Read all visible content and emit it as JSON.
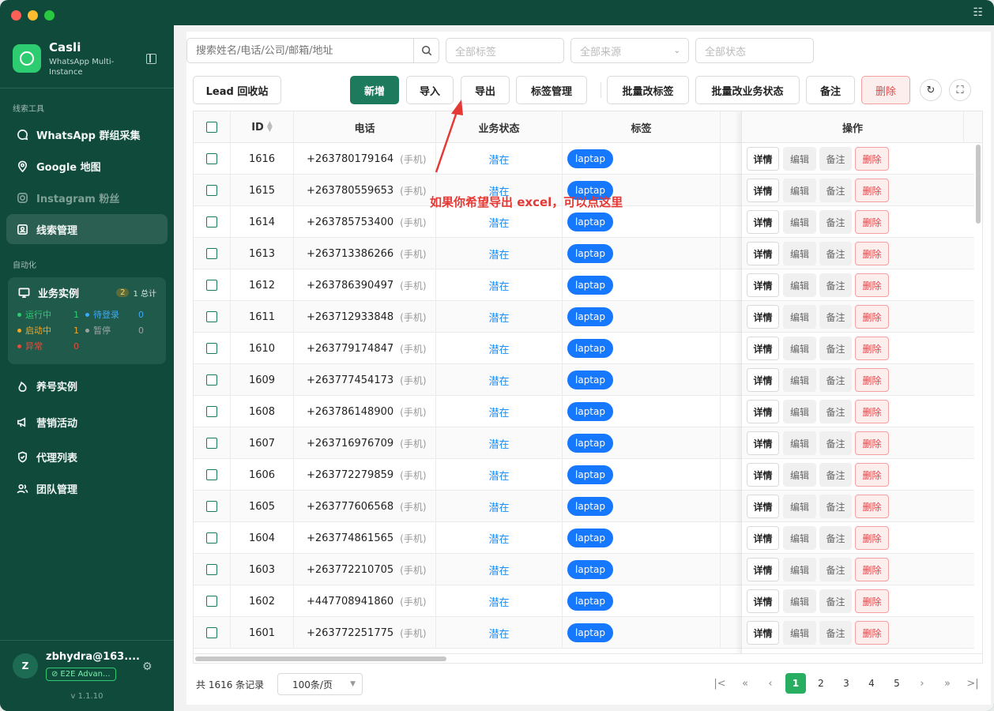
{
  "window": {
    "corner_icon": "checklist-icon"
  },
  "brand": {
    "title": "Casli",
    "subtitle": "WhatsApp Multi-Instance"
  },
  "sidebar": {
    "section_leads": "线索工具",
    "items": [
      {
        "label": "WhatsApp 群组采集",
        "icon": "chat-icon"
      },
      {
        "label": "Google 地图",
        "icon": "map-pin-icon"
      },
      {
        "label": "Instagram 粉丝",
        "icon": "instagram-icon"
      },
      {
        "label": "线索管理",
        "icon": "contacts-icon"
      }
    ],
    "section_auto": "自动化",
    "business": {
      "title": "业务实例",
      "count_badge": "2",
      "total_label": "1 总计",
      "stats": [
        {
          "label": "运行中",
          "value": "1",
          "color": "#2ecc71"
        },
        {
          "label": "待登录",
          "value": "0",
          "color": "#3fa9f5"
        },
        {
          "label": "启动中",
          "value": "1",
          "color": "#f5a623"
        },
        {
          "label": "暂停",
          "value": "0",
          "color": "#9aa5a1"
        },
        {
          "label": "异常",
          "value": "0",
          "color": "#e74c3c"
        }
      ]
    },
    "items2": [
      {
        "label": "养号实例",
        "icon": "flame-icon"
      },
      {
        "label": "营销活动",
        "icon": "megaphone-icon"
      },
      {
        "label": "代理列表",
        "icon": "shield-icon"
      },
      {
        "label": "团队管理",
        "icon": "team-icon"
      }
    ],
    "user": {
      "initial": "Z",
      "name": "zbhydra@163....",
      "plan": "E2E Advan...",
      "version": "v 1.1.10"
    }
  },
  "filters": {
    "search_placeholder": "搜索姓名/电话/公司/邮箱/地址",
    "tags": "全部标签",
    "source": "全部来源",
    "status": "全部状态"
  },
  "toolbar": {
    "recycle": "Lead 回收站",
    "add": "新增",
    "import": "导入",
    "export": "导出",
    "tag_manage": "标签管理",
    "batch_tag": "批量改标签",
    "batch_status": "批量改业务状态",
    "note": "备注",
    "delete": "删除"
  },
  "table": {
    "headers": {
      "id": "ID",
      "phone": "电话",
      "status": "业务状态",
      "tag": "标签",
      "ops": "操作"
    },
    "phone_type": "(手机)",
    "op_labels": {
      "detail": "详情",
      "edit": "编辑",
      "note": "备注",
      "delete": "删除"
    },
    "rows": [
      {
        "id": "1616",
        "phone": "+263780179164",
        "status": "潜在",
        "tag": "laptap"
      },
      {
        "id": "1615",
        "phone": "+263780559653",
        "status": "潜在",
        "tag": "laptap"
      },
      {
        "id": "1614",
        "phone": "+263785753400",
        "status": "潜在",
        "tag": "laptap"
      },
      {
        "id": "1613",
        "phone": "+263713386266",
        "status": "潜在",
        "tag": "laptap"
      },
      {
        "id": "1612",
        "phone": "+263786390497",
        "status": "潜在",
        "tag": "laptap"
      },
      {
        "id": "1611",
        "phone": "+263712933848",
        "status": "潜在",
        "tag": "laptap"
      },
      {
        "id": "1610",
        "phone": "+263779174847",
        "status": "潜在",
        "tag": "laptap"
      },
      {
        "id": "1609",
        "phone": "+263777454173",
        "status": "潜在",
        "tag": "laptap"
      },
      {
        "id": "1608",
        "phone": "+263786148900",
        "status": "潜在",
        "tag": "laptap"
      },
      {
        "id": "1607",
        "phone": "+263716976709",
        "status": "潜在",
        "tag": "laptap"
      },
      {
        "id": "1606",
        "phone": "+263772279859",
        "status": "潜在",
        "tag": "laptap"
      },
      {
        "id": "1605",
        "phone": "+263777606568",
        "status": "潜在",
        "tag": "laptap"
      },
      {
        "id": "1604",
        "phone": "+263774861565",
        "status": "潜在",
        "tag": "laptap"
      },
      {
        "id": "1603",
        "phone": "+263772210705",
        "status": "潜在",
        "tag": "laptap"
      },
      {
        "id": "1602",
        "phone": "+447708941860",
        "status": "潜在",
        "tag": "laptap"
      },
      {
        "id": "1601",
        "phone": "+263772251775",
        "status": "潜在",
        "tag": "laptap"
      }
    ]
  },
  "annotation": {
    "text": "如果你希望导出 excel，可以点这里"
  },
  "pagination": {
    "total": "共 1616 条记录",
    "page_size": "100条/页",
    "pages": [
      "1",
      "2",
      "3",
      "4",
      "5"
    ],
    "current": "1"
  },
  "colors": {
    "brand": "#0f4a3b",
    "primary": "#1d7a5d",
    "tag": "#1677ff",
    "danger": "#e04848",
    "annotation": "#e53935"
  }
}
